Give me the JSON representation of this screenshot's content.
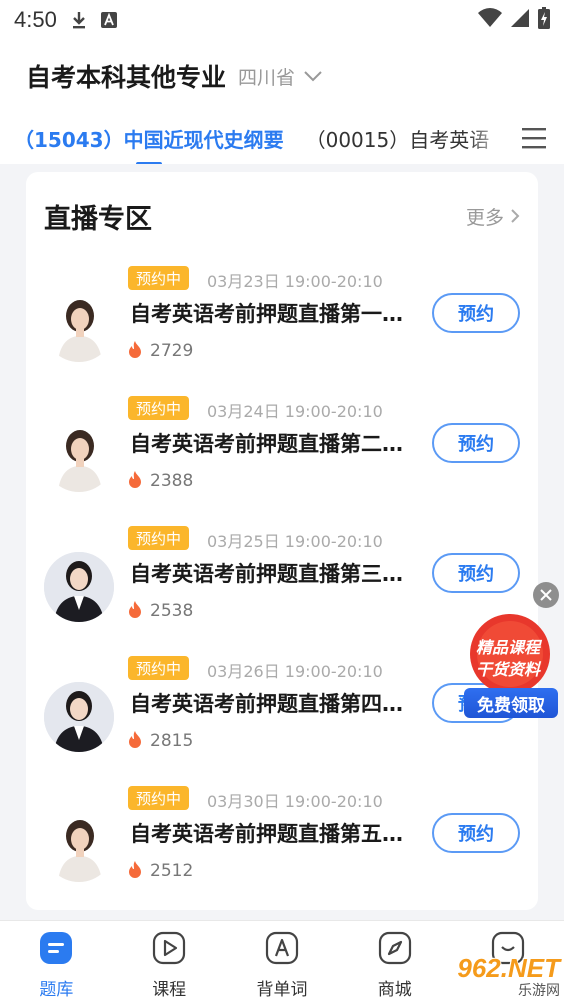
{
  "status_bar": {
    "time": "4:50"
  },
  "header": {
    "title": "自考本科其他专业",
    "region": "四川省"
  },
  "tabs": [
    {
      "label": "（15043）中国近现代史纲要",
      "active": true
    },
    {
      "label": "（00015）自考英语",
      "active": false
    }
  ],
  "live": {
    "title": "直播专区",
    "more": "更多"
  },
  "items": [
    {
      "badge": "预约中",
      "time": "03月23日 19:00-20:10",
      "title": "自考英语考前押题直播第一…",
      "count": "2729",
      "button": "预约"
    },
    {
      "badge": "预约中",
      "time": "03月24日 19:00-20:10",
      "title": "自考英语考前押题直播第二…",
      "count": "2388",
      "button": "预约"
    },
    {
      "badge": "预约中",
      "time": "03月25日 19:00-20:10",
      "title": "自考英语考前押题直播第三…",
      "count": "2538",
      "button": "预约"
    },
    {
      "badge": "预约中",
      "time": "03月26日 19:00-20:10",
      "title": "自考英语考前押题直播第四…",
      "count": "2815",
      "button": "预约"
    },
    {
      "badge": "预约中",
      "time": "03月30日 19:00-20:10",
      "title": "自考英语考前押题直播第五…",
      "count": "2512",
      "button": "预约"
    }
  ],
  "promo": {
    "line1": "精品课程",
    "line2": "干货资料",
    "button": "免费领取"
  },
  "nav": [
    {
      "label": "题库",
      "icon": "question-bank-icon",
      "active": true
    },
    {
      "label": "课程",
      "icon": "play-icon",
      "active": false
    },
    {
      "label": "背单词",
      "icon": "vocabulary-icon",
      "active": false
    },
    {
      "label": "商城",
      "icon": "compass-icon",
      "active": false
    },
    {
      "label": "",
      "icon": "profile-icon",
      "active": false
    }
  ],
  "watermark": {
    "main": "962.NET",
    "sub": "乐游网"
  },
  "colors": {
    "accent": "#2b7bf0",
    "badge": "#fbb62b",
    "hot": "#f56a3a"
  }
}
